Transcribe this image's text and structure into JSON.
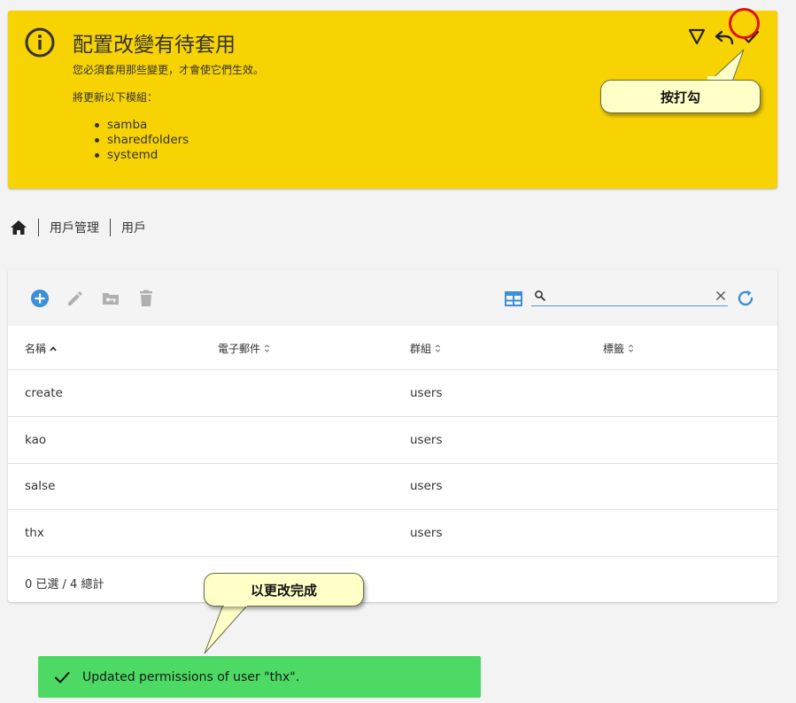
{
  "banner": {
    "title": "配置改變有待套用",
    "message": "您必須套用那些變更，才會使它們生效。",
    "modules_intro": "將更新以下模組：",
    "modules": [
      "samba",
      "sharedfolders",
      "systemd"
    ],
    "color": "#f8d303"
  },
  "annotations": {
    "apply_note": "按打勾",
    "done_note": "以更改完成",
    "highlight_color": "#e01010"
  },
  "breadcrumb": [
    "用戶管理",
    "用戶"
  ],
  "toolbar": {
    "search": {
      "value": "",
      "placeholder": ""
    }
  },
  "table": {
    "columns": [
      "名稱",
      "電子郵件",
      "群組",
      "標籤"
    ],
    "rows": [
      {
        "name": "create",
        "email": "",
        "groups": "users",
        "tags": ""
      },
      {
        "name": "kao",
        "email": "",
        "groups": "users",
        "tags": ""
      },
      {
        "name": "salse",
        "email": "",
        "groups": "users",
        "tags": ""
      },
      {
        "name": "thx",
        "email": "",
        "groups": "users",
        "tags": ""
      }
    ],
    "footer": "0 已選 / 4 總計"
  },
  "toast": {
    "message": "Updated permissions of user \"thx\".",
    "color": "#4cd964"
  },
  "icons": {
    "info": "info-icon",
    "filter": "filter-icon",
    "undo": "undo-icon",
    "apply": "check-icon",
    "home": "home-icon",
    "add": "plus-circle-icon",
    "edit": "pencil-icon",
    "share": "folder-key-icon",
    "delete": "trash-icon",
    "columns": "table-columns-icon",
    "search": "search-icon",
    "clear": "close-icon",
    "refresh": "refresh-icon"
  }
}
